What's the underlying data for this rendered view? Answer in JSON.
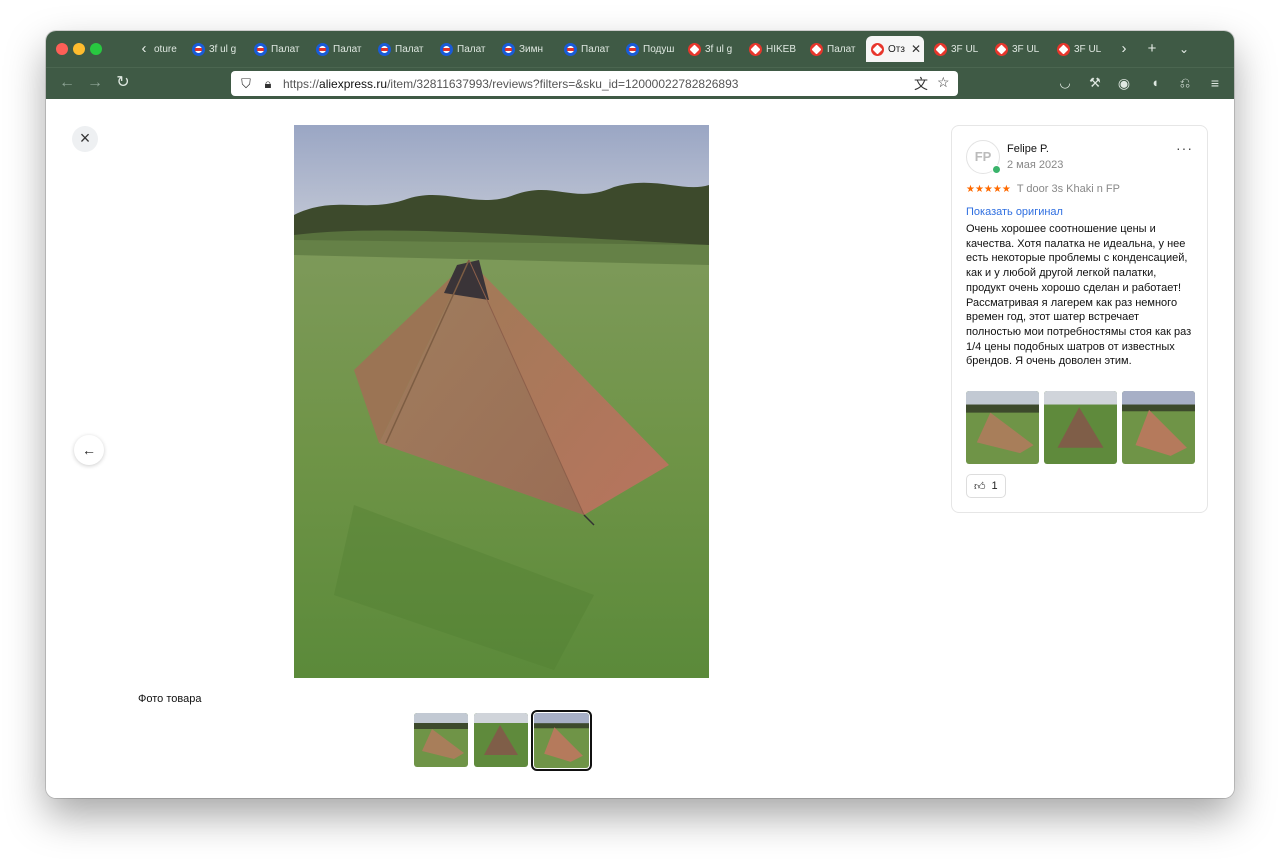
{
  "browser": {
    "tabs": [
      {
        "label": "oture",
        "favicon": "chevron-left-icon"
      },
      {
        "label": "3f ul g",
        "favicon": "ozon-icon"
      },
      {
        "label": "Палат",
        "favicon": "ozon-icon"
      },
      {
        "label": "Палат",
        "favicon": "ozon-icon"
      },
      {
        "label": "Палат",
        "favicon": "ozon-icon"
      },
      {
        "label": "Палат",
        "favicon": "ozon-icon"
      },
      {
        "label": "Зимн",
        "favicon": "ozon-icon"
      },
      {
        "label": "Палат",
        "favicon": "ozon-icon"
      },
      {
        "label": "Подуш",
        "favicon": "ozon-icon"
      },
      {
        "label": "3f ul g",
        "favicon": "aliexpress-icon"
      },
      {
        "label": "HIKEB",
        "favicon": "aliexpress-icon"
      },
      {
        "label": "Палат",
        "favicon": "aliexpress-icon"
      },
      {
        "label": "Отз",
        "favicon": "aliexpress-icon",
        "active": true
      },
      {
        "label": "3F UL",
        "favicon": "aliexpress-icon"
      },
      {
        "label": "3F UL",
        "favicon": "aliexpress-icon"
      },
      {
        "label": "3F UL",
        "favicon": "aliexpress-icon"
      }
    ],
    "url_prefix": "https://",
    "url_host": "aliexpress.ru",
    "url_path": "/item/32811637993/reviews?filters=&sku_id=12000022782826893",
    "colors": {
      "chrome": "#3f5a45",
      "link": "#2f6fe0",
      "stars": "#ff6a00"
    }
  },
  "viewer": {
    "caption": "Фото товара",
    "thumbnail_count": 3,
    "active_thumbnail": 3
  },
  "review": {
    "avatar_initials": "FP",
    "author": "Felipe P.",
    "date": "2 мая 2023",
    "stars": "★★★★★",
    "rating": 5,
    "variant": "T door 3s Khaki n FP",
    "show_original": "Показать оригинал",
    "text": "Очень хорошее соотношение цены и качества. Хотя палатка не идеальна, у нее есть некоторые проблемы с конденсацией, как и у любой другой легкой палатки, продукт очень хорошо сделан и работает! Рассматривая я лагерем как раз немного времен год, этот шатер встречает полностью мои потребностямы стоя как раз 1/4 цены подобных шатров от известных брендов. Я очень доволен этим.",
    "likes": "1",
    "more": "···"
  }
}
